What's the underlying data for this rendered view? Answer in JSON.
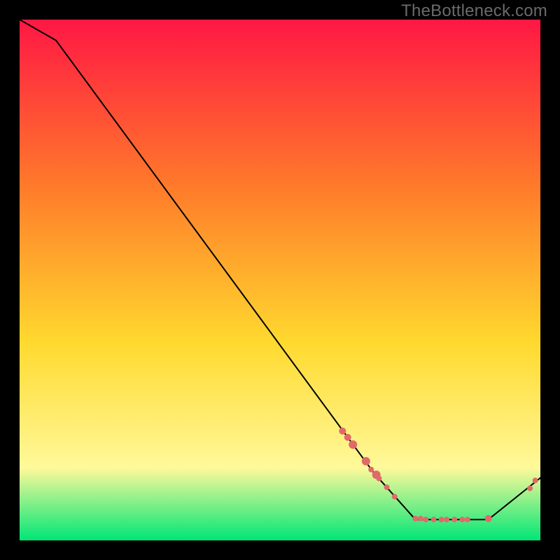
{
  "watermark": "TheBottleneck.com",
  "chart_data": {
    "type": "line",
    "title": "",
    "xlabel": "",
    "ylabel": "",
    "xlim": [
      0,
      100
    ],
    "ylim": [
      0,
      100
    ],
    "background_gradient": {
      "top": "#ff1744",
      "mid1": "#ff7a2a",
      "mid2": "#ffd92e",
      "mid3": "#fff99a",
      "bottom": "#00e676"
    },
    "line_points": [
      {
        "x": 0,
        "y": 100
      },
      {
        "x": 7,
        "y": 96
      },
      {
        "x": 68,
        "y": 13
      },
      {
        "x": 76,
        "y": 4
      },
      {
        "x": 90,
        "y": 4
      },
      {
        "x": 100,
        "y": 12
      }
    ],
    "marker_points": [
      {
        "x": 62,
        "y": 21.0,
        "r": 5
      },
      {
        "x": 63,
        "y": 19.8,
        "r": 5
      },
      {
        "x": 64,
        "y": 18.4,
        "r": 6
      },
      {
        "x": 66.5,
        "y": 15.2,
        "r": 6
      },
      {
        "x": 67.5,
        "y": 13.6,
        "r": 4
      },
      {
        "x": 68.5,
        "y": 12.6,
        "r": 6
      },
      {
        "x": 69,
        "y": 11.9,
        "r": 4
      },
      {
        "x": 70.5,
        "y": 10.2,
        "r": 4
      },
      {
        "x": 72,
        "y": 8.4,
        "r": 4
      },
      {
        "x": 76,
        "y": 4.2,
        "r": 4
      },
      {
        "x": 77,
        "y": 4.2,
        "r": 4
      },
      {
        "x": 78,
        "y": 4.0,
        "r": 4
      },
      {
        "x": 79.5,
        "y": 4.0,
        "r": 4
      },
      {
        "x": 81,
        "y": 4.0,
        "r": 4
      },
      {
        "x": 82,
        "y": 4.0,
        "r": 4
      },
      {
        "x": 83.5,
        "y": 4.0,
        "r": 4
      },
      {
        "x": 85,
        "y": 4.0,
        "r": 4
      },
      {
        "x": 86,
        "y": 4.0,
        "r": 4
      },
      {
        "x": 90,
        "y": 4.2,
        "r": 5
      },
      {
        "x": 98,
        "y": 10.0,
        "r": 4
      },
      {
        "x": 99,
        "y": 11.5,
        "r": 4
      }
    ],
    "line_color": "#000000",
    "marker_color": "#e06a6a"
  }
}
